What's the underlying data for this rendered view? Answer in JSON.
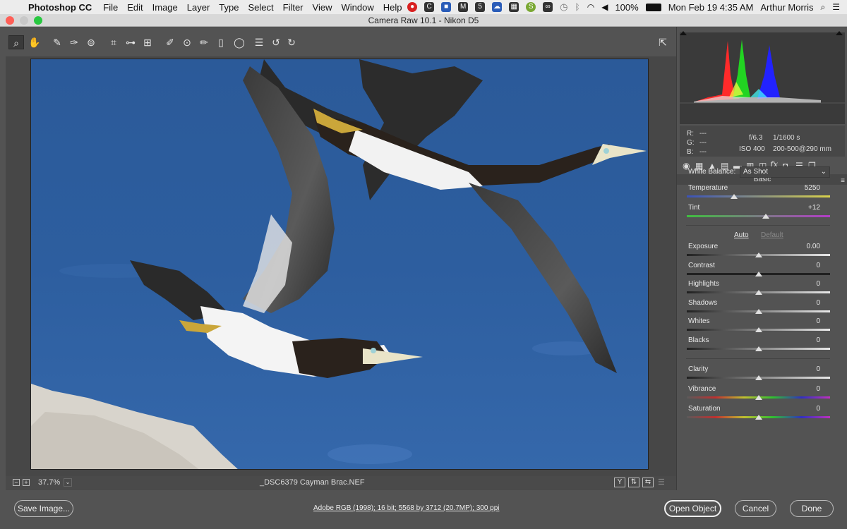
{
  "menubar": {
    "app_name": "Photoshop CC",
    "menus": [
      "File",
      "Edit",
      "Image",
      "Layer",
      "Type",
      "Select",
      "Filter",
      "View",
      "Window",
      "Help"
    ],
    "battery": "100%",
    "datetime": "Mon Feb 19  4:35 AM",
    "user": "Arthur Morris"
  },
  "window": {
    "title": "Camera Raw 10.1  -  Nikon D5"
  },
  "toolbar": {
    "tools": [
      "zoom-tool",
      "hand-tool",
      "white-balance-tool",
      "color-sampler-tool",
      "targeted-adjustment-tool",
      "crop-tool",
      "straighten-tool",
      "transform-tool",
      "spot-removal-tool",
      "red-eye-removal-tool",
      "adjustment-brush",
      "graduated-filter",
      "radial-filter",
      "open-preferences",
      "rotate-left",
      "rotate-right"
    ]
  },
  "status": {
    "zoom": "37.7%",
    "filename": "_DSC6379  Cayman Brac.NEF"
  },
  "footer": {
    "save_label": "Save Image...",
    "workflow_link": "Adobe RGB (1998); 16 bit; 5568 by 3712 (20.7MP); 300 ppi",
    "open_label": "Open Object",
    "cancel_label": "Cancel",
    "done_label": "Done"
  },
  "info": {
    "r": "R:",
    "g": "G:",
    "b": "B:",
    "r_val": "---",
    "g_val": "---",
    "b_val": "---",
    "aperture": "f/6.3",
    "shutter": "1/1600 s",
    "iso": "ISO 400",
    "lens": "200-500@290 mm"
  },
  "panel": {
    "title": "Basic",
    "white_balance_label": "White Balance:",
    "white_balance_value": "As Shot",
    "auto_label": "Auto",
    "default_label": "Default",
    "sliders": [
      {
        "label": "Temperature",
        "value": "5250",
        "pos": 0.33
      },
      {
        "label": "Tint",
        "value": "+12",
        "pos": 0.55
      },
      {
        "label": "Exposure",
        "value": "0.00",
        "pos": 0.5
      },
      {
        "label": "Contrast",
        "value": "0",
        "pos": 0.5
      },
      {
        "label": "Highlights",
        "value": "0",
        "pos": 0.5
      },
      {
        "label": "Shadows",
        "value": "0",
        "pos": 0.5
      },
      {
        "label": "Whites",
        "value": "0",
        "pos": 0.5
      },
      {
        "label": "Blacks",
        "value": "0",
        "pos": 0.5
      },
      {
        "label": "Clarity",
        "value": "0",
        "pos": 0.5
      },
      {
        "label": "Vibrance",
        "value": "0",
        "pos": 0.5
      },
      {
        "label": "Saturation",
        "value": "0",
        "pos": 0.5
      }
    ]
  },
  "colors": {
    "water": "#2c5c9e",
    "accent": "#ffffff"
  }
}
